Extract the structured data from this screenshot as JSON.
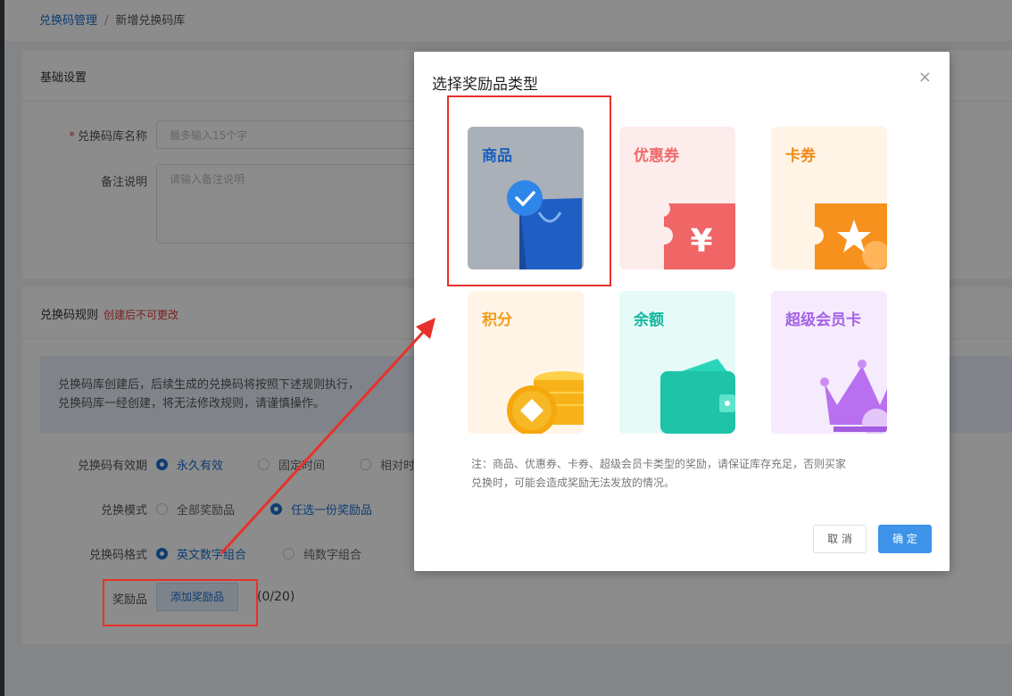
{
  "breadcrumb": {
    "parent": "兑换码管理",
    "separator": "/",
    "current": "新增兑换码库"
  },
  "basic": {
    "title": "基础设置",
    "name_label": "兑换码库名称",
    "name_placeholder": "最多输入15个字",
    "remark_label": "备注说明",
    "remark_placeholder": "请输入备注说明"
  },
  "rules": {
    "title": "兑换码规则",
    "warning": "创建后不可更改",
    "notice_line1": "兑换码库创建后，后续生成的兑换码将按照下述规则执行，",
    "notice_line2": "兑换码库一经创建，将无法修改规则，请谨慎操作。",
    "validity_label": "兑换码有效期",
    "validity_options": [
      "永久有效",
      "固定时间",
      "相对时"
    ],
    "mode_label": "兑换模式",
    "mode_options": [
      "全部奖励品",
      "任选一份奖励品"
    ],
    "format_label": "兑换码格式",
    "format_options": [
      "英文数字组合",
      "纯数字组合"
    ],
    "reward_label": "奖励品",
    "add_reward": "添加奖励品",
    "reward_count": "(0/20)"
  },
  "dialog": {
    "title": "选择奖励品类型",
    "close": "×",
    "types": [
      {
        "label": "商品",
        "color": "#1a6fd0",
        "selected": true
      },
      {
        "label": "优惠券",
        "color": "#f06a6a"
      },
      {
        "label": "卡券",
        "color": "#f28a1a"
      },
      {
        "label": "积分",
        "color": "#f29a1a"
      },
      {
        "label": "余额",
        "color": "#14b6a0"
      },
      {
        "label": "超级会员卡",
        "color": "#a463e6"
      }
    ],
    "note_line1": "注：商品、优惠券、卡券、超级会员卡类型的奖励，请保证库存充足，否则买家",
    "note_line2": "兑换时，可能会造成奖励无法发放的情况。",
    "cancel": "取 消",
    "confirm": "确 定"
  }
}
